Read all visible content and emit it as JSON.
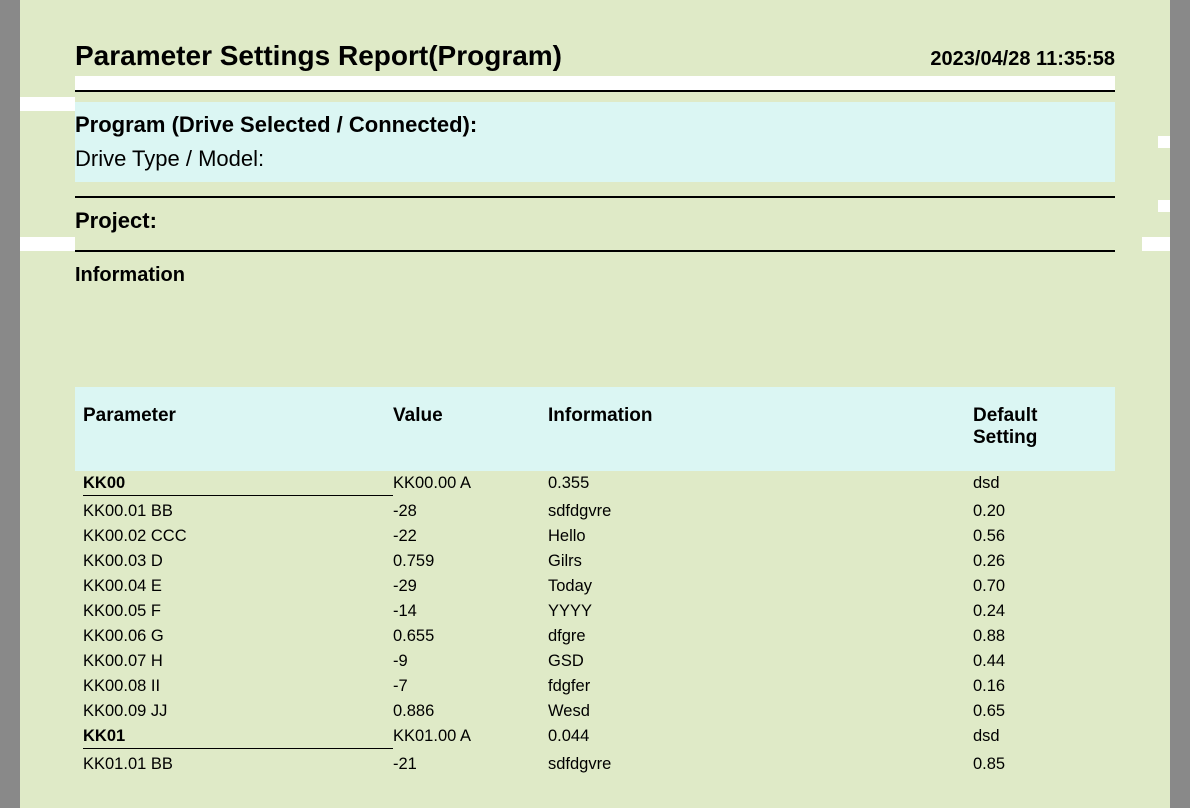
{
  "header": {
    "title": "Parameter Settings Report(Program)",
    "timestamp": "2023/04/28 11:35:58"
  },
  "meta": {
    "program_label": "Program (Drive Selected / Connected):",
    "drive_type_label": "Drive Type / Model:",
    "project_label": "Project:",
    "information_heading": "Information"
  },
  "table": {
    "col_parameter": "Parameter",
    "col_value": "Value",
    "col_information": "Information",
    "col_default": "Default Setting",
    "rows": [
      {
        "group": true,
        "parameter": "KK00",
        "value": "KK00.00 A",
        "info": "0.355",
        "def": "dsd"
      },
      {
        "group": false,
        "parameter": "KK00.01 BB",
        "value": "-28",
        "info": "sdfdgvre",
        "def": "0.20"
      },
      {
        "group": false,
        "parameter": "KK00.02 CCC",
        "value": "-22",
        "info": "Hello",
        "def": "0.56"
      },
      {
        "group": false,
        "parameter": "KK00.03 D",
        "value": "0.759",
        "info": "Gilrs",
        "def": "0.26"
      },
      {
        "group": false,
        "parameter": "KK00.04 E",
        "value": "-29",
        "info": "Today",
        "def": "0.70"
      },
      {
        "group": false,
        "parameter": "KK00.05 F",
        "value": "-14",
        "info": "YYYY",
        "def": "0.24"
      },
      {
        "group": false,
        "parameter": "KK00.06 G",
        "value": "0.655",
        "info": "dfgre",
        "def": "0.88"
      },
      {
        "group": false,
        "parameter": "KK00.07 H",
        "value": "-9",
        "info": "GSD",
        "def": "0.44"
      },
      {
        "group": false,
        "parameter": "KK00.08 II",
        "value": "-7",
        "info": "fdgfer",
        "def": "0.16"
      },
      {
        "group": false,
        "parameter": "KK00.09 JJ",
        "value": "0.886",
        "info": "Wesd",
        "def": "0.65"
      },
      {
        "group": true,
        "parameter": "KK01",
        "value": "KK01.00 A",
        "info": "0.044",
        "def": "dsd"
      },
      {
        "group": false,
        "parameter": "KK01.01 BB",
        "value": "-21",
        "info": "sdfdgvre",
        "def": "0.85"
      }
    ]
  }
}
